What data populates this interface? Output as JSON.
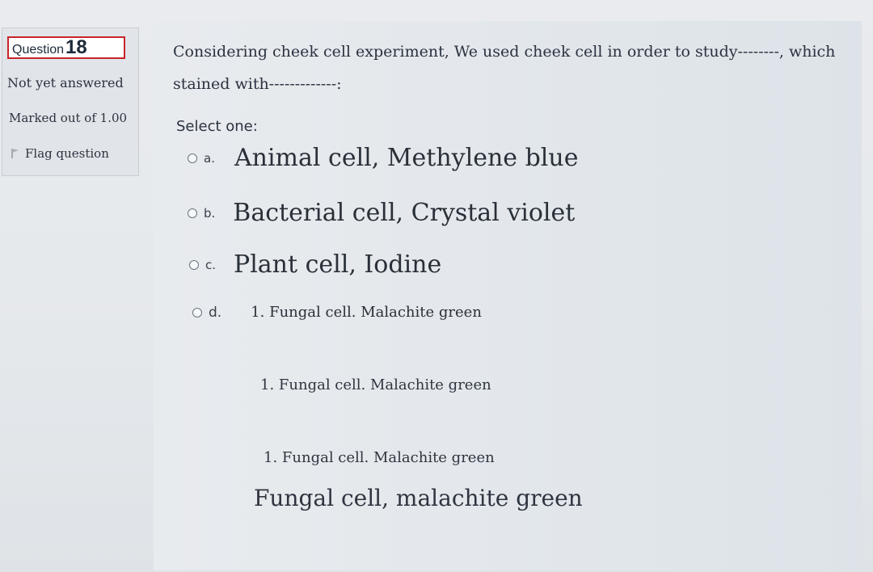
{
  "question": {
    "label": "Question",
    "number": "18",
    "state": "Not yet answered",
    "mark": "Marked out of 1.00",
    "flag_label": "Flag question"
  },
  "content": {
    "text_line1": "Considering cheek cell experiment, We used cheek cell in order to study--------, which",
    "text_line2": "stained with-------------:",
    "select_label": "Select one:"
  },
  "options": [
    {
      "letter": "a.",
      "text": "Animal cell, Methylene blue"
    },
    {
      "letter": "b.",
      "text": "Bacterial cell, Crystal violet"
    },
    {
      "letter": "c.",
      "text": "Plant cell, Iodine"
    },
    {
      "letter": "d.",
      "text": "1. Fungal cell. Malachite green"
    }
  ],
  "option_d_extra": [
    "1. Fungal cell. Malachite green",
    "1. Fungal cell. Malachite green",
    "Fungal cell, malachite green"
  ],
  "colors": {
    "accent_border": "#c8242b"
  }
}
